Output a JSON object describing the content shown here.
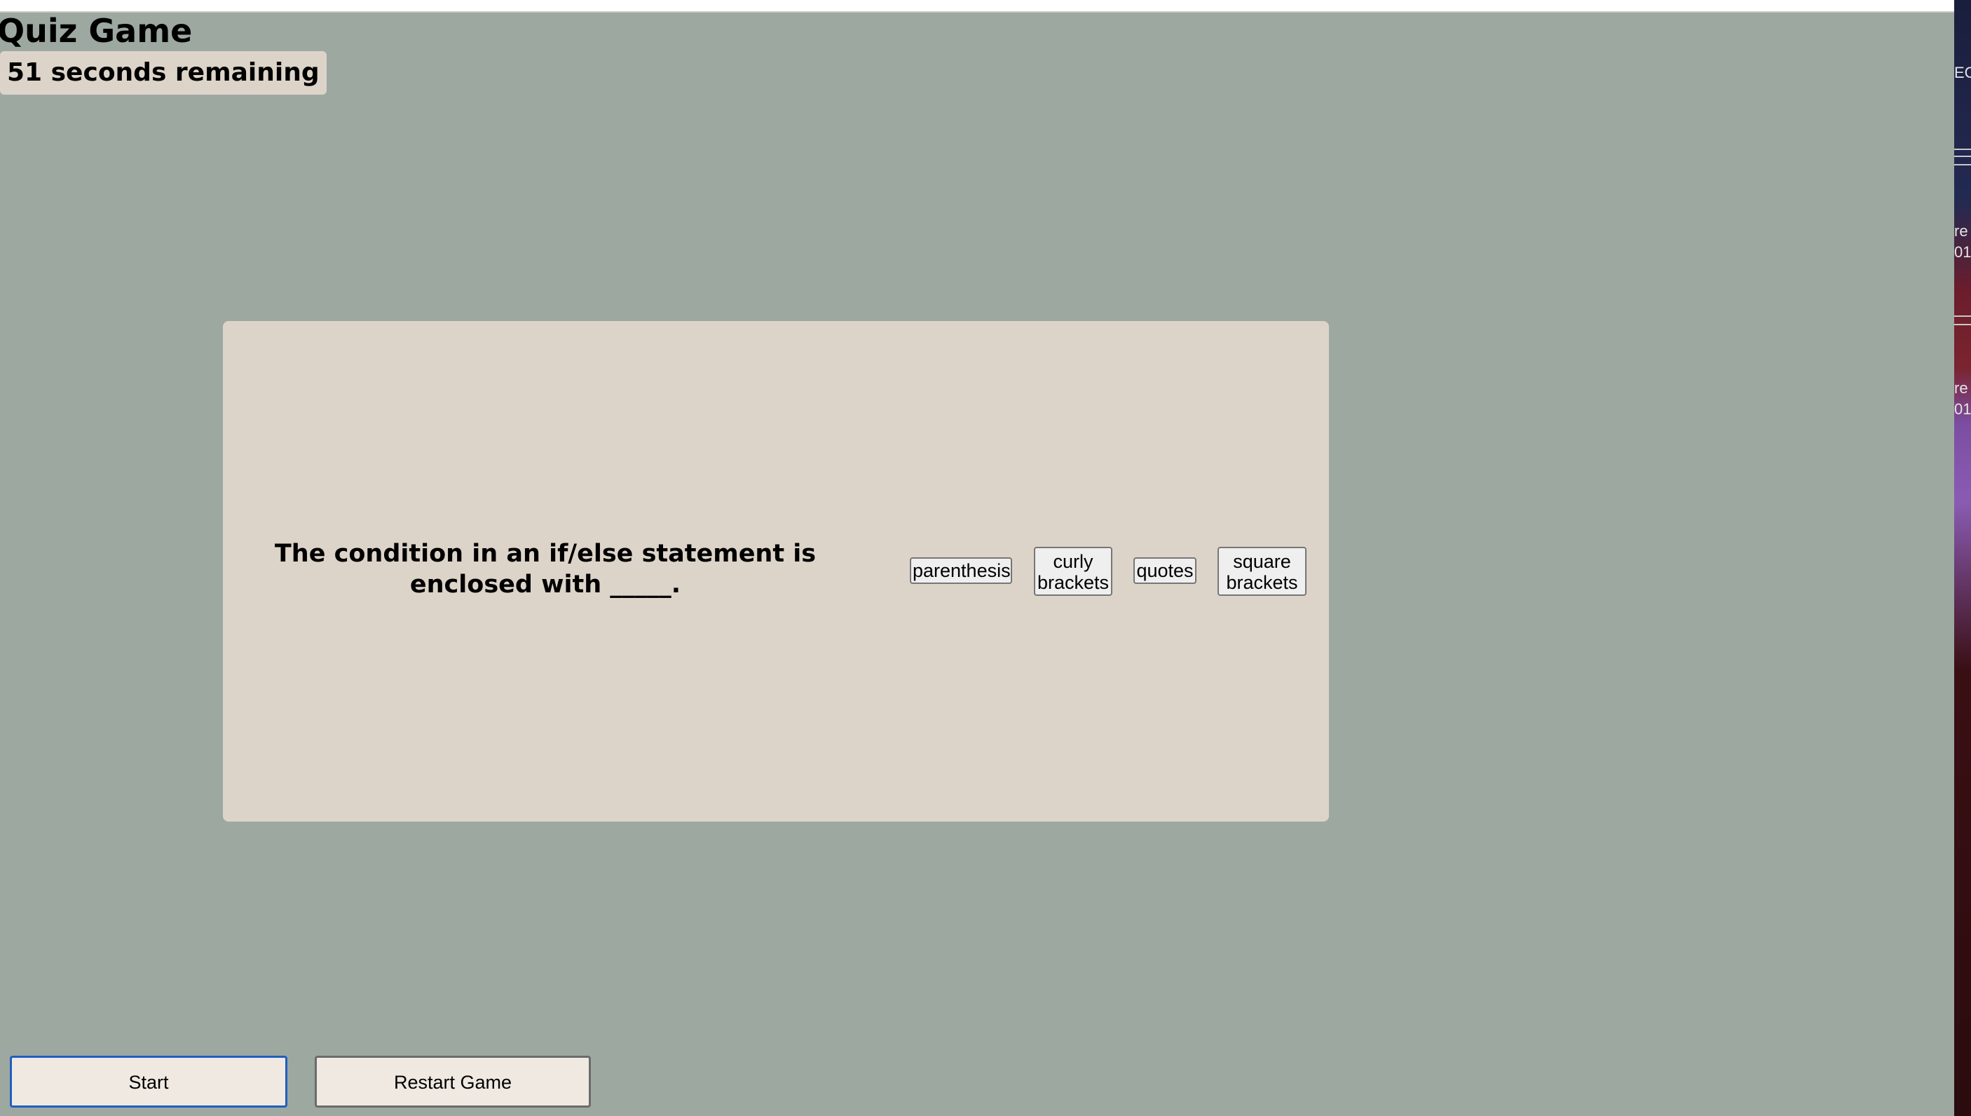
{
  "app": {
    "title": "Quiz Game",
    "timer_text": "51 seconds remaining"
  },
  "quiz": {
    "question": "The condition in an if/else statement is enclosed with _____.",
    "choices": [
      {
        "line1": "parenthesis",
        "line2": ""
      },
      {
        "line1": "curly",
        "line2": "brackets"
      },
      {
        "line1": "quotes",
        "line2": ""
      },
      {
        "line1": "square",
        "line2": "brackets"
      }
    ]
  },
  "controls": {
    "start_label": "Start",
    "restart_label": "Restart Game"
  },
  "background_edge": {
    "fragments": [
      "EC",
      "re",
      "01",
      "re",
      "01"
    ]
  },
  "colors": {
    "page_background": "#9da8a1",
    "panel_background": "#ddd4c9",
    "start_focus_border": "#1f5fbf",
    "button_background": "#efe9e2"
  }
}
